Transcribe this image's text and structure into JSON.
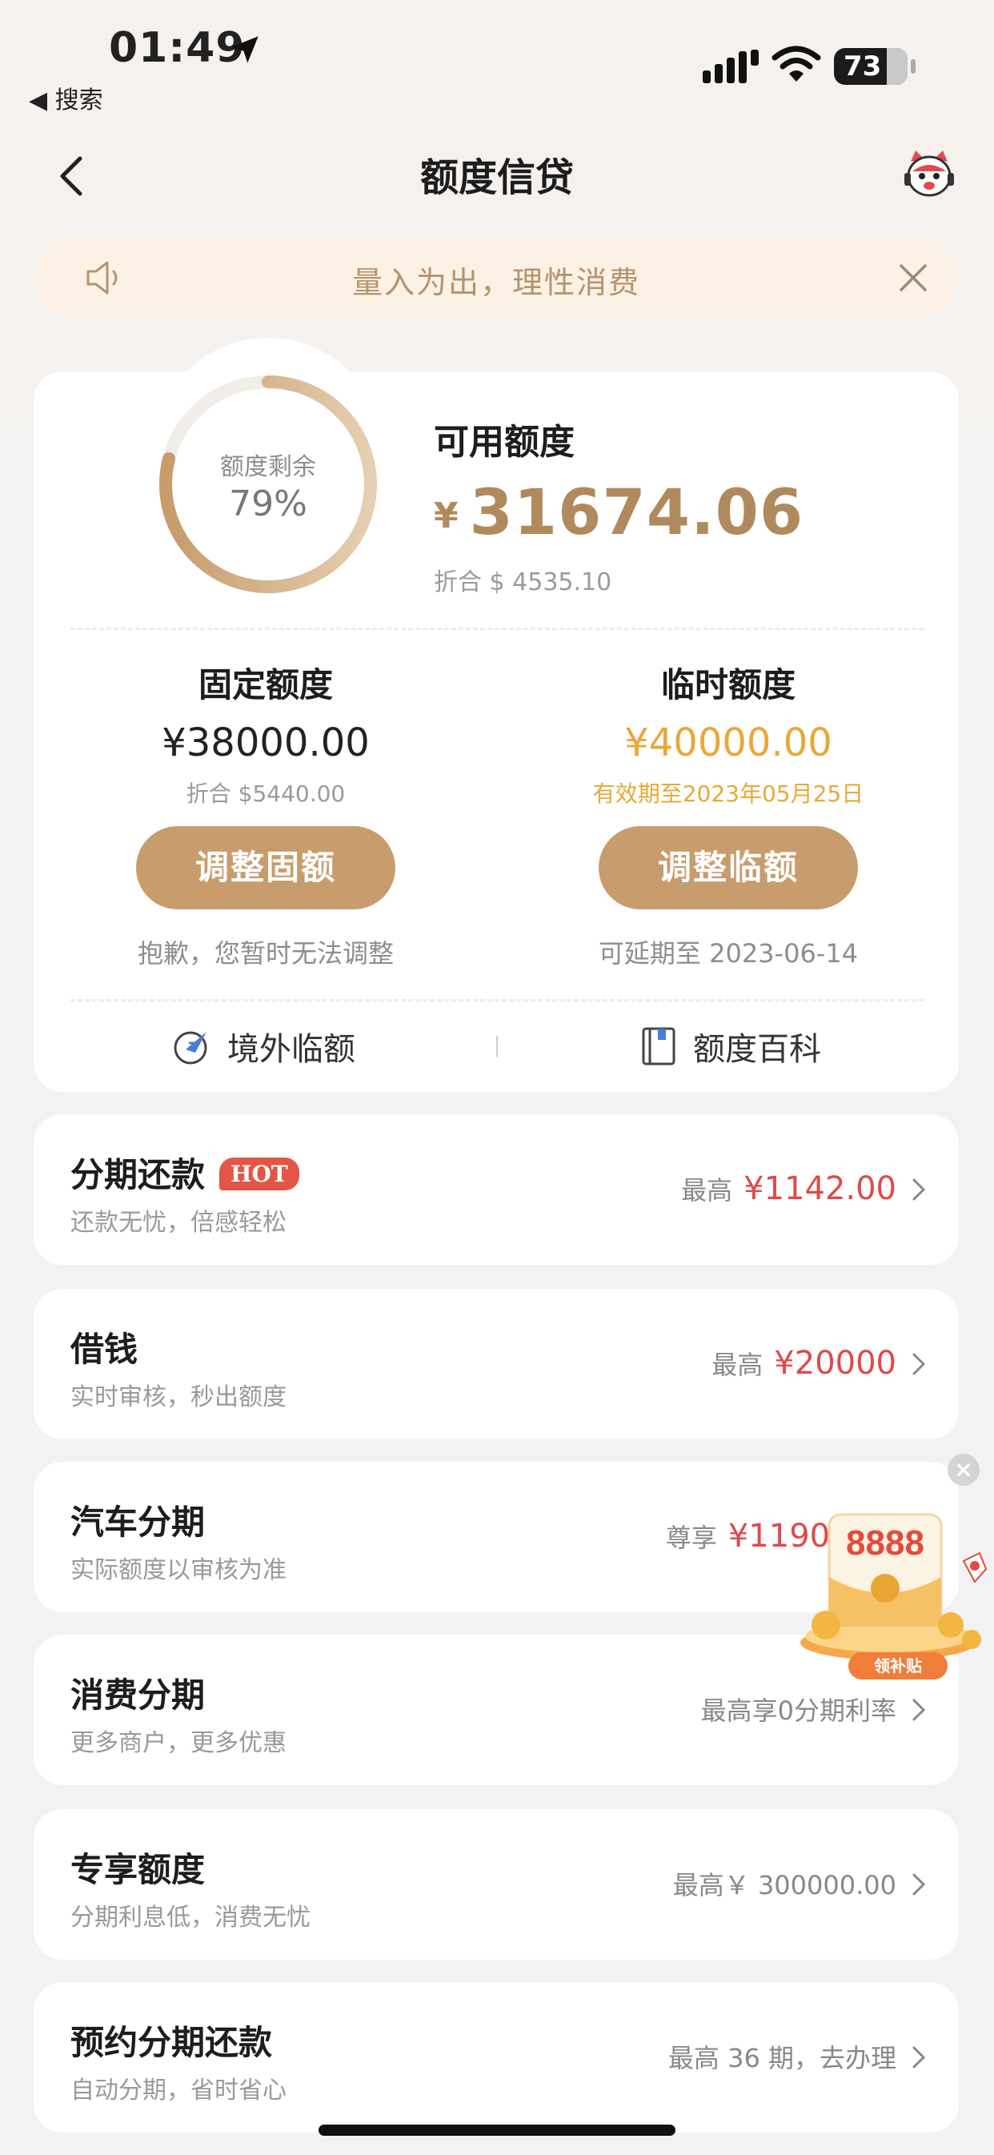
{
  "status_bar": {
    "time": "01:49",
    "back_app": "◀ 搜索",
    "battery": "73"
  },
  "nav": {
    "title": "额度信贷"
  },
  "notice": {
    "text": "量入为出，理性消费"
  },
  "summary": {
    "ring_label": "额度剩余",
    "ring_value": "79%",
    "ring_percent": 79,
    "available_label": "可用额度",
    "available_currency": "¥",
    "available_amount": "31674.06",
    "available_usd": "折合 $ 4535.10"
  },
  "fixed": {
    "title": "固定额度",
    "amount": "¥38000.00",
    "sub": "折合 $5440.00",
    "button": "调整固额",
    "note": "抱歉，您暂时无法调整"
  },
  "temp": {
    "title": "临时额度",
    "amount": "¥40000.00",
    "sub": "有效期至2023年05月25日",
    "button": "调整临额",
    "note": "可延期至 2023-06-14"
  },
  "quick": {
    "left": "境外临额",
    "right": "额度百科"
  },
  "rows": [
    {
      "title": "分期还款",
      "badge": "HOT",
      "sub": "还款无忧，倍感轻松",
      "prefix": "最高",
      "amount": "¥1142.00"
    },
    {
      "title": "借钱",
      "sub": "实时审核，秒出额度",
      "prefix": "最高",
      "amount": "¥20000"
    },
    {
      "title": "汽车分期",
      "sub": "实际额度以审核为准",
      "prefix": "尊享",
      "amount": "¥119000"
    },
    {
      "title": "消费分期",
      "sub": "更多商户，更多优惠",
      "prefix": "最高享0分期利率"
    },
    {
      "title": "专享额度",
      "sub": "分期利息低，消费无忧",
      "prefix": "最高￥ 300000.00"
    },
    {
      "title": "预约分期还款",
      "sub": "自动分期，省时省心",
      "prefix": "最高 36 期，去办理"
    }
  ],
  "promo": {
    "number": "8888",
    "button": "领补贴"
  },
  "colors": {
    "gold": "#c89c6d",
    "red": "#e04949",
    "orange": "#e9a836"
  }
}
